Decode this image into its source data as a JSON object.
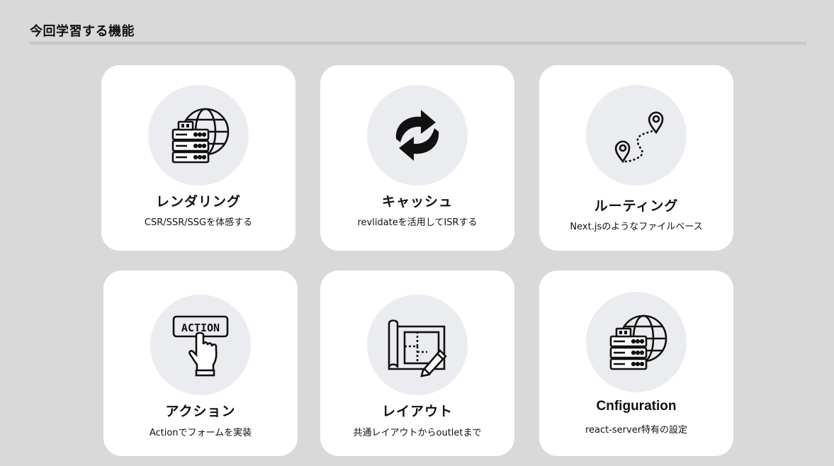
{
  "header": {
    "title": "今回学習する機能"
  },
  "cards": [
    {
      "title": "レンダリング",
      "description": "CSR/SSR/SSGを体感する",
      "icon": "server-globe-icon"
    },
    {
      "title": "キャッシュ",
      "description": "revlidateを活用してISRする",
      "icon": "refresh-arrows-icon"
    },
    {
      "title": "ルーティング",
      "description": "Next.jsのようなファイルベース",
      "icon": "route-map-pins-icon"
    },
    {
      "title": "アクション",
      "description": "Actionでフォームを実装",
      "icon": "action-button-hand-icon",
      "icon_text": "ACTION"
    },
    {
      "title": "レイアウト",
      "description": "共通レイアウトからoutletまで",
      "icon": "blueprint-pencil-icon"
    },
    {
      "title": "Cnfiguration",
      "description": "react-server特有の設定",
      "icon": "server-globe-icon"
    }
  ],
  "colors": {
    "background": "#d9d9d9",
    "card": "#ffffff",
    "icon_circle": "#eaecef",
    "text": "#111111"
  }
}
